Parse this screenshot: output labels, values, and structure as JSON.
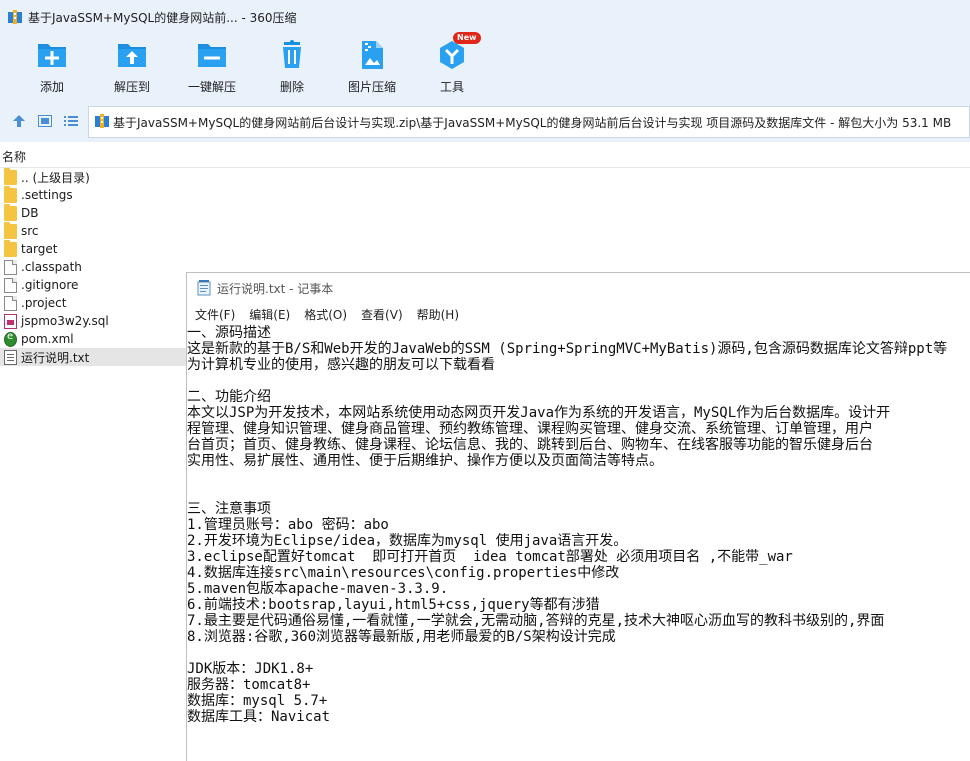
{
  "window": {
    "title": "基于JavaSSM+MySQL的健身网站前... - 360压缩"
  },
  "toolbar": {
    "items": [
      {
        "label": "添加",
        "icon": "add-icon"
      },
      {
        "label": "解压到",
        "icon": "extract-to-icon"
      },
      {
        "label": "一键解压",
        "icon": "one-click-extract-icon"
      },
      {
        "label": "删除",
        "icon": "delete-icon"
      },
      {
        "label": "图片压缩",
        "icon": "image-compress-icon"
      },
      {
        "label": "工具",
        "icon": "tools-icon",
        "badge": "New"
      }
    ]
  },
  "addressbar": {
    "path": "基于JavaSSM+MySQL的健身网站前后台设计与实现.zip\\基于JavaSSM+MySQL的健身网站前后台设计与实现 项目源码及数据库文件 - 解包大小为 53.1 MB"
  },
  "filelist": {
    "column_header": "名称",
    "items": [
      {
        "name": ".. (上级目录)",
        "type": "folder"
      },
      {
        "name": ".settings",
        "type": "folder"
      },
      {
        "name": "DB",
        "type": "folder"
      },
      {
        "name": "src",
        "type": "folder"
      },
      {
        "name": "target",
        "type": "folder"
      },
      {
        "name": ".classpath",
        "type": "file"
      },
      {
        "name": ".gitignore",
        "type": "file"
      },
      {
        "name": ".project",
        "type": "file"
      },
      {
        "name": "jspmo3w2y.sql",
        "type": "sql"
      },
      {
        "name": "pom.xml",
        "type": "xml"
      },
      {
        "name": "运行说明.txt",
        "type": "txt",
        "selected": true
      }
    ]
  },
  "notepad": {
    "title": "运行说明.txt - 记事本",
    "menus": [
      "文件(F)",
      "编辑(E)",
      "格式(O)",
      "查看(V)",
      "帮助(H)"
    ],
    "lines": [
      "一、源码描述",
      "这是新款的基于B/S和Web开发的JavaWeb的SSM (Spring+SpringMVC+MyBatis)源码,包含源码数据库论文答辩ppt等",
      "为计算机专业的使用，感兴趣的朋友可以下载看看",
      "",
      "二、功能介绍",
      "本文以JSP为开发技术，本网站系统使用动态网页开发Java作为系统的开发语言，MySQL作为后台数据库。设计开",
      "程管理、健身知识管理、健身商品管理、预约教练管理、课程购买管理、健身交流、系统管理、订单管理，用户",
      "台首页；首页、健身教练、健身课程、论坛信息、我的、跳转到后台、购物车、在线客服等功能的智乐健身后台",
      "实用性、易扩展性、通用性、便于后期维护、操作方便以及页面简洁等特点。",
      "",
      "",
      "三、注意事项",
      "1.管理员账号：abo 密码：abo",
      "2.开发环境为Eclipse/idea，数据库为mysql 使用java语言开发。",
      "3.eclipse配置好tomcat  即可打开首页  idea tomcat部署处 必须用项目名 ,不能带_war",
      "4.数据库连接src\\main\\resources\\config.properties中修改",
      "5.maven包版本apache-maven-3.3.9.",
      "6.前端技术:bootsrap,layui,html5+css,jquery等都有涉猎",
      "7.最主要是代码通俗易懂,一看就懂,一学就会,无需动脑,答辩的克星,技术大神呕心沥血写的教科书级别的,界面",
      "8.浏览器:谷歌,360浏览器等最新版,用老师最爱的B/S架构设计完成",
      "",
      "JDK版本：JDK1.8+",
      "服务器：tomcat8+",
      "数据库：mysql 5.7+",
      "数据库工具：Navicat"
    ]
  },
  "colors": {
    "toolbar_bg": "#e9f1fb",
    "icon_blue": "#1a8fe0",
    "badge_red": "#e0271a",
    "folder_yellow": "#f6c443",
    "selected_row": "#e5e5e5"
  }
}
